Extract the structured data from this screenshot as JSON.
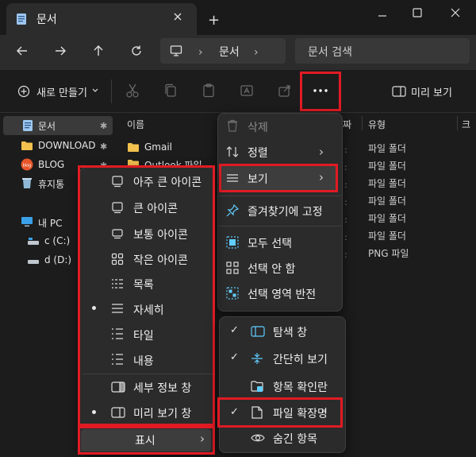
{
  "window": {
    "tab_title": "문서",
    "new_tab_symbol": "+",
    "icons": [
      "document-icon",
      "close-icon",
      "minimize-icon",
      "maximize-icon"
    ]
  },
  "address": {
    "crumbs": [
      "문서"
    ],
    "search_placeholder": "문서 검색"
  },
  "toolbar": {
    "new_label": "새로 만들기",
    "preview_label": "미리 보기",
    "more_symbol": "···"
  },
  "sidebar": {
    "items": [
      {
        "label": "문서",
        "pinned": true,
        "icon": "document-icon"
      },
      {
        "label": "DOWNLOAD",
        "pinned": true,
        "icon": "folder-icon"
      },
      {
        "label": "BLOG",
        "pinned": true,
        "icon": "blog-icon"
      },
      {
        "label": "휴지통",
        "pinned": true,
        "icon": "recycle-bin-icon"
      },
      {
        "label": "내 PC",
        "pinned": false,
        "icon": "pc-icon"
      },
      {
        "label": "c (C:)",
        "pinned": false,
        "icon": "drive-icon"
      },
      {
        "label": "d (D:)",
        "pinned": false,
        "icon": "drive-icon"
      }
    ],
    "pin_symbol": "✱"
  },
  "filelist": {
    "columns": {
      "name": "이름",
      "date": "짜",
      "type": "유형",
      "size": "크"
    },
    "rows": [
      {
        "name": "Gmail",
        "type": "파일 폴더"
      },
      {
        "name": "Outlook 파일",
        "type": "파일 폴더"
      },
      {
        "name": "",
        "type": "파일 폴더"
      },
      {
        "name": "",
        "type": "파일 폴더"
      },
      {
        "name": "",
        "type": "파일 폴더"
      },
      {
        "name": "",
        "type": "파일 폴더"
      },
      {
        "name": "",
        "type": "PNG 파일"
      }
    ]
  },
  "more_menu": {
    "delete": "삭제",
    "sort": "정렬",
    "view": "보기",
    "pin": "즐겨찾기에 고정",
    "select_all": "모두 선택",
    "select_none": "선택 안 함",
    "invert": "선택 영역 반전"
  },
  "view_menu": {
    "items": [
      "아주 큰 아이콘",
      "큰 아이콘",
      "보통 아이콘",
      "작은 아이콘",
      "목록",
      "자세히",
      "타일",
      "내용"
    ],
    "selected_layout": "자세히",
    "details_pane": "세부 정보 창",
    "preview_pane": "미리 보기 창",
    "show": "표시"
  },
  "show_menu": {
    "items": [
      {
        "label": "탐색 창",
        "checked": true
      },
      {
        "label": "간단히 보기",
        "checked": true
      },
      {
        "label": "항목 확인란",
        "checked": false
      },
      {
        "label": "파일 확장명",
        "checked": true
      },
      {
        "label": "숨긴 항목",
        "checked": false
      }
    ]
  },
  "colors": {
    "accent": "#60cdff",
    "highlight_border": "#e01b24",
    "folder": "#f2c14e"
  }
}
